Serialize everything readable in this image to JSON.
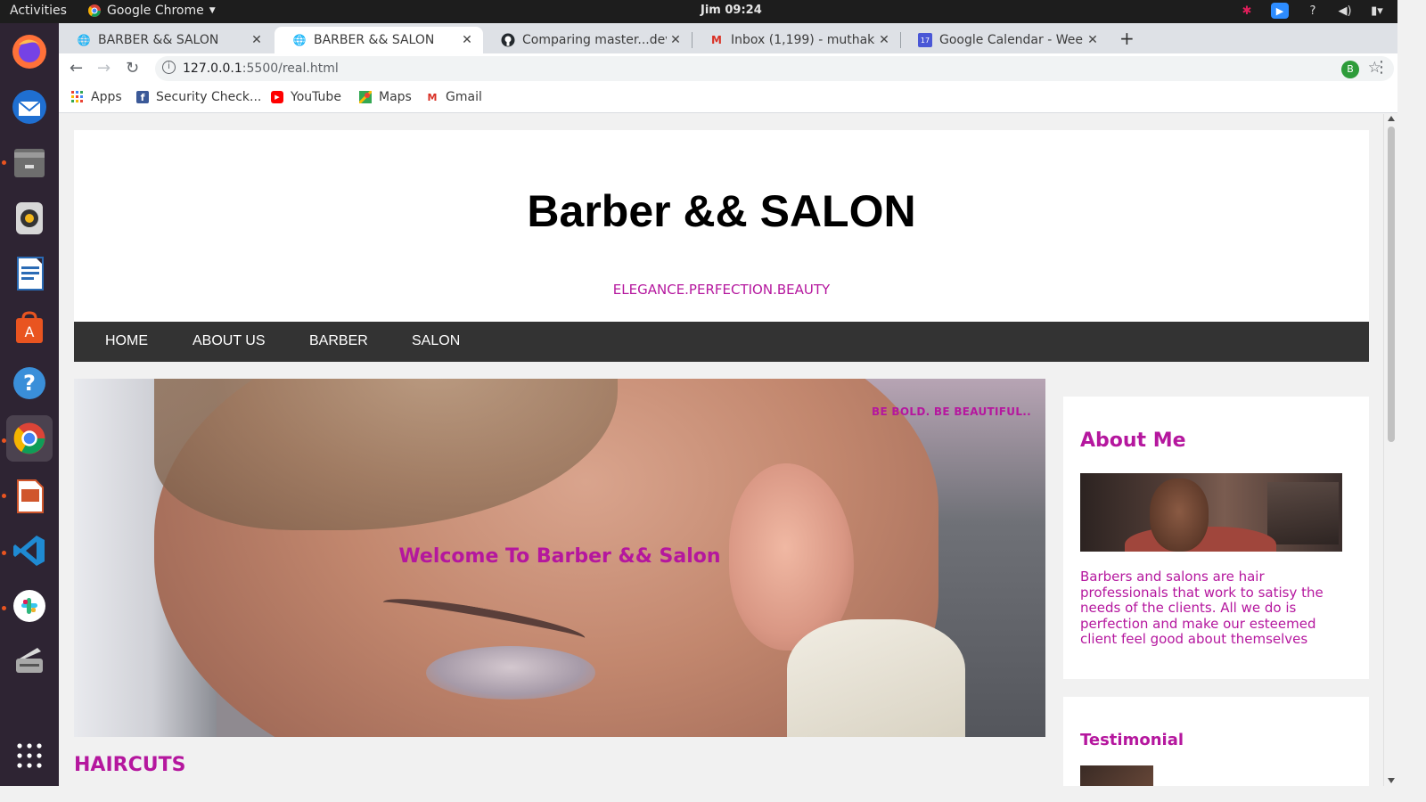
{
  "system": {
    "activities": "Activities",
    "app_name": "Google Chrome",
    "clock": "Jim 09:24"
  },
  "browser": {
    "tabs": [
      {
        "title": "BARBER && SALON",
        "active": false
      },
      {
        "title": "BARBER && SALON",
        "active": true
      },
      {
        "title": "Comparing master...devel",
        "active": false
      },
      {
        "title": "Inbox (1,199) - muthakab",
        "active": false
      },
      {
        "title": "Google Calendar - Week o",
        "active": false
      }
    ],
    "url_host": "127.0.0.1",
    "url_path": ":5500/real.html",
    "profile_initial": "B",
    "bookmarks": [
      "Apps",
      "Security Check...",
      "YouTube",
      "Maps",
      "Gmail"
    ]
  },
  "page": {
    "site_title": "Barber && SALON",
    "tagline": "ELEGANCE.PERFECTION.BEAUTY",
    "nav": [
      "HOME",
      "ABOUT US",
      "BARBER",
      "SALON"
    ],
    "hero": {
      "welcome": "Welcome To Barber && Salon",
      "slogan": "BE BOLD. BE BEAUTIFUL.."
    },
    "section_title": "HAIRCUTS",
    "about": {
      "heading": "About Me",
      "text": "Barbers and salons are hair professionals that work to satisy the needs of the clients. All we do is perfection and make our esteemed client feel good about themselves"
    },
    "testimonial": {
      "heading": "Testimonial"
    }
  },
  "colors": {
    "accent": "#b5179e",
    "navbar": "#333333",
    "dock": "#2e2433"
  }
}
